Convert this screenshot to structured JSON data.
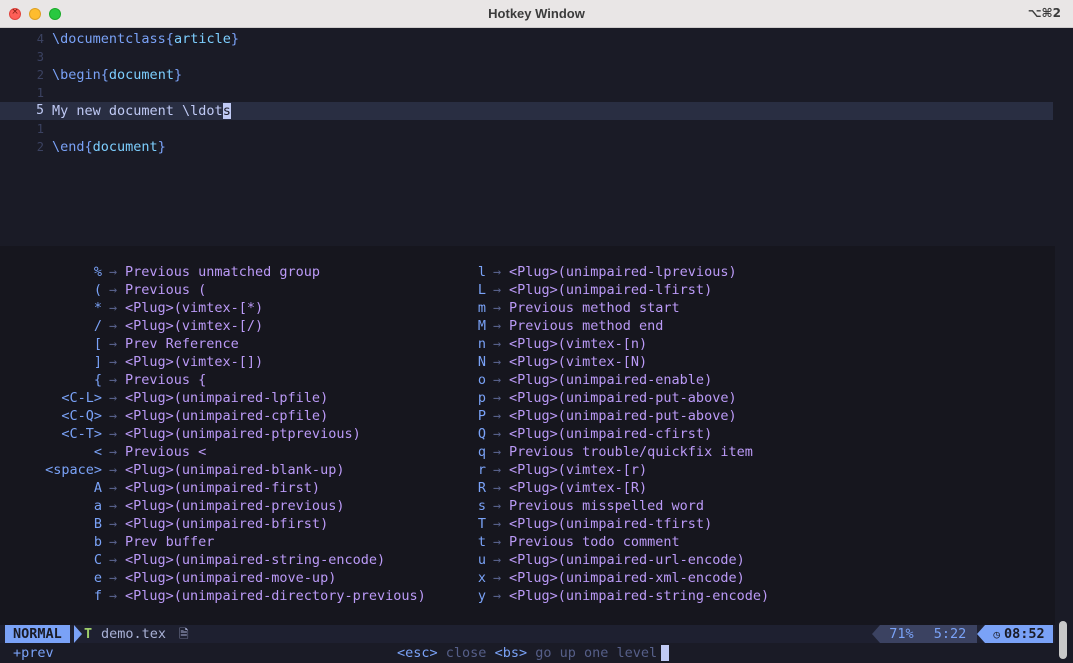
{
  "window": {
    "title": "Hotkey Window",
    "shortcut": "⌥⌘2",
    "close_glyph": "×"
  },
  "editor": {
    "lines": [
      {
        "number": "4",
        "cmd": "\\documentclass",
        "open": "{",
        "arg": "article",
        "close": "}"
      },
      {
        "number": "3",
        "text": ""
      },
      {
        "number": "2",
        "cmd": "\\begin",
        "open": "{",
        "arg": "document",
        "close": "}"
      },
      {
        "number": "1",
        "text": ""
      },
      {
        "number": "5",
        "text_before_cursor": "My new document \\ldot",
        "cursor_char": "s",
        "current": true
      },
      {
        "number": "1",
        "text": ""
      },
      {
        "number": "2",
        "cmd": "\\end",
        "open": "{",
        "arg": "document",
        "close": "}"
      }
    ]
  },
  "which_key": {
    "arrow": "→",
    "left": [
      {
        "key": "%",
        "desc": "Previous unmatched group"
      },
      {
        "key": "(",
        "desc": "Previous ("
      },
      {
        "key": "*",
        "desc": "<Plug>(vimtex-[*)"
      },
      {
        "key": "/",
        "desc": "<Plug>(vimtex-[/)"
      },
      {
        "key": "[",
        "desc": "Prev Reference"
      },
      {
        "key": "]",
        "desc": "<Plug>(vimtex-[])"
      },
      {
        "key": "{",
        "desc": "Previous {"
      },
      {
        "key": "<C-L>",
        "desc": "<Plug>(unimpaired-lpfile)"
      },
      {
        "key": "<C-Q>",
        "desc": "<Plug>(unimpaired-cpfile)"
      },
      {
        "key": "<C-T>",
        "desc": "<Plug>(unimpaired-ptprevious)"
      },
      {
        "key": "<",
        "desc": "Previous <"
      },
      {
        "key": "<space>",
        "desc": "<Plug>(unimpaired-blank-up)"
      },
      {
        "key": "A",
        "desc": "<Plug>(unimpaired-first)"
      },
      {
        "key": "a",
        "desc": "<Plug>(unimpaired-previous)"
      },
      {
        "key": "B",
        "desc": "<Plug>(unimpaired-bfirst)"
      },
      {
        "key": "b",
        "desc": "Prev buffer"
      },
      {
        "key": "C",
        "desc": "<Plug>(unimpaired-string-encode)"
      },
      {
        "key": "e",
        "desc": "<Plug>(unimpaired-move-up)"
      },
      {
        "key": "f",
        "desc": "<Plug>(unimpaired-directory-previous)"
      }
    ],
    "right": [
      {
        "key": "l",
        "desc": "<Plug>(unimpaired-lprevious)"
      },
      {
        "key": "L",
        "desc": "<Plug>(unimpaired-lfirst)"
      },
      {
        "key": "m",
        "desc": "Previous method start"
      },
      {
        "key": "M",
        "desc": "Previous method end"
      },
      {
        "key": "n",
        "desc": "<Plug>(vimtex-[n)"
      },
      {
        "key": "N",
        "desc": "<Plug>(vimtex-[N)"
      },
      {
        "key": "o",
        "desc": "<Plug>(unimpaired-enable)"
      },
      {
        "key": "p",
        "desc": "<Plug>(unimpaired-put-above)"
      },
      {
        "key": "P",
        "desc": "<Plug>(unimpaired-put-above)"
      },
      {
        "key": "Q",
        "desc": "<Plug>(unimpaired-cfirst)"
      },
      {
        "key": "q",
        "desc": "Previous trouble/quickfix item"
      },
      {
        "key": "r",
        "desc": "<Plug>(vimtex-[r)"
      },
      {
        "key": "R",
        "desc": "<Plug>(vimtex-[R)"
      },
      {
        "key": "s",
        "desc": "Previous misspelled word"
      },
      {
        "key": "T",
        "desc": "<Plug>(unimpaired-tfirst)"
      },
      {
        "key": "t",
        "desc": "Previous todo comment"
      },
      {
        "key": "u",
        "desc": "<Plug>(unimpaired-url-encode)"
      },
      {
        "key": "x",
        "desc": "<Plug>(unimpaired-xml-encode)"
      },
      {
        "key": "y",
        "desc": "<Plug>(unimpaired-string-encode)"
      }
    ]
  },
  "statusline": {
    "mode": "NORMAL",
    "filetype_icon": "T",
    "filename": "demo.tex",
    "file_icon": "🗎",
    "percent": "71%",
    "position": "5:22",
    "clock_icon": "◷",
    "time": "08:52"
  },
  "cmdline": {
    "left": "+prev",
    "esc_key": "<esc>",
    "esc_desc": "close",
    "bs_key": "<bs>",
    "bs_desc": "go up one level"
  },
  "colors": {
    "background": "#1a1b26",
    "accent": "#7aa2f7",
    "description": "#bb9af7"
  }
}
